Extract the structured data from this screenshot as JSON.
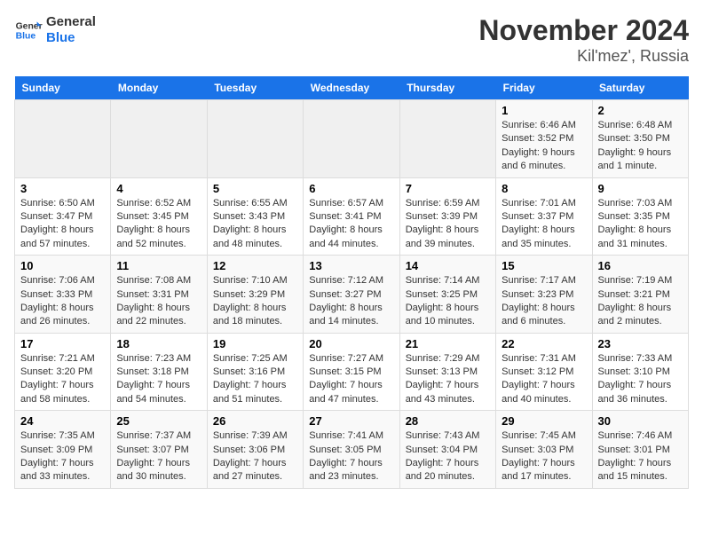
{
  "logo": {
    "line1": "General",
    "line2": "Blue"
  },
  "title": "November 2024",
  "subtitle": "Kil'mez', Russia",
  "weekdays": [
    "Sunday",
    "Monday",
    "Tuesday",
    "Wednesday",
    "Thursday",
    "Friday",
    "Saturday"
  ],
  "weeks": [
    [
      {
        "day": "",
        "info": ""
      },
      {
        "day": "",
        "info": ""
      },
      {
        "day": "",
        "info": ""
      },
      {
        "day": "",
        "info": ""
      },
      {
        "day": "",
        "info": ""
      },
      {
        "day": "1",
        "info": "Sunrise: 6:46 AM\nSunset: 3:52 PM\nDaylight: 9 hours\nand 6 minutes."
      },
      {
        "day": "2",
        "info": "Sunrise: 6:48 AM\nSunset: 3:50 PM\nDaylight: 9 hours\nand 1 minute."
      }
    ],
    [
      {
        "day": "3",
        "info": "Sunrise: 6:50 AM\nSunset: 3:47 PM\nDaylight: 8 hours\nand 57 minutes."
      },
      {
        "day": "4",
        "info": "Sunrise: 6:52 AM\nSunset: 3:45 PM\nDaylight: 8 hours\nand 52 minutes."
      },
      {
        "day": "5",
        "info": "Sunrise: 6:55 AM\nSunset: 3:43 PM\nDaylight: 8 hours\nand 48 minutes."
      },
      {
        "day": "6",
        "info": "Sunrise: 6:57 AM\nSunset: 3:41 PM\nDaylight: 8 hours\nand 44 minutes."
      },
      {
        "day": "7",
        "info": "Sunrise: 6:59 AM\nSunset: 3:39 PM\nDaylight: 8 hours\nand 39 minutes."
      },
      {
        "day": "8",
        "info": "Sunrise: 7:01 AM\nSunset: 3:37 PM\nDaylight: 8 hours\nand 35 minutes."
      },
      {
        "day": "9",
        "info": "Sunrise: 7:03 AM\nSunset: 3:35 PM\nDaylight: 8 hours\nand 31 minutes."
      }
    ],
    [
      {
        "day": "10",
        "info": "Sunrise: 7:06 AM\nSunset: 3:33 PM\nDaylight: 8 hours\nand 26 minutes."
      },
      {
        "day": "11",
        "info": "Sunrise: 7:08 AM\nSunset: 3:31 PM\nDaylight: 8 hours\nand 22 minutes."
      },
      {
        "day": "12",
        "info": "Sunrise: 7:10 AM\nSunset: 3:29 PM\nDaylight: 8 hours\nand 18 minutes."
      },
      {
        "day": "13",
        "info": "Sunrise: 7:12 AM\nSunset: 3:27 PM\nDaylight: 8 hours\nand 14 minutes."
      },
      {
        "day": "14",
        "info": "Sunrise: 7:14 AM\nSunset: 3:25 PM\nDaylight: 8 hours\nand 10 minutes."
      },
      {
        "day": "15",
        "info": "Sunrise: 7:17 AM\nSunset: 3:23 PM\nDaylight: 8 hours\nand 6 minutes."
      },
      {
        "day": "16",
        "info": "Sunrise: 7:19 AM\nSunset: 3:21 PM\nDaylight: 8 hours\nand 2 minutes."
      }
    ],
    [
      {
        "day": "17",
        "info": "Sunrise: 7:21 AM\nSunset: 3:20 PM\nDaylight: 7 hours\nand 58 minutes."
      },
      {
        "day": "18",
        "info": "Sunrise: 7:23 AM\nSunset: 3:18 PM\nDaylight: 7 hours\nand 54 minutes."
      },
      {
        "day": "19",
        "info": "Sunrise: 7:25 AM\nSunset: 3:16 PM\nDaylight: 7 hours\nand 51 minutes."
      },
      {
        "day": "20",
        "info": "Sunrise: 7:27 AM\nSunset: 3:15 PM\nDaylight: 7 hours\nand 47 minutes."
      },
      {
        "day": "21",
        "info": "Sunrise: 7:29 AM\nSunset: 3:13 PM\nDaylight: 7 hours\nand 43 minutes."
      },
      {
        "day": "22",
        "info": "Sunrise: 7:31 AM\nSunset: 3:12 PM\nDaylight: 7 hours\nand 40 minutes."
      },
      {
        "day": "23",
        "info": "Sunrise: 7:33 AM\nSunset: 3:10 PM\nDaylight: 7 hours\nand 36 minutes."
      }
    ],
    [
      {
        "day": "24",
        "info": "Sunrise: 7:35 AM\nSunset: 3:09 PM\nDaylight: 7 hours\nand 33 minutes."
      },
      {
        "day": "25",
        "info": "Sunrise: 7:37 AM\nSunset: 3:07 PM\nDaylight: 7 hours\nand 30 minutes."
      },
      {
        "day": "26",
        "info": "Sunrise: 7:39 AM\nSunset: 3:06 PM\nDaylight: 7 hours\nand 27 minutes."
      },
      {
        "day": "27",
        "info": "Sunrise: 7:41 AM\nSunset: 3:05 PM\nDaylight: 7 hours\nand 23 minutes."
      },
      {
        "day": "28",
        "info": "Sunrise: 7:43 AM\nSunset: 3:04 PM\nDaylight: 7 hours\nand 20 minutes."
      },
      {
        "day": "29",
        "info": "Sunrise: 7:45 AM\nSunset: 3:03 PM\nDaylight: 7 hours\nand 17 minutes."
      },
      {
        "day": "30",
        "info": "Sunrise: 7:46 AM\nSunset: 3:01 PM\nDaylight: 7 hours\nand 15 minutes."
      }
    ]
  ]
}
